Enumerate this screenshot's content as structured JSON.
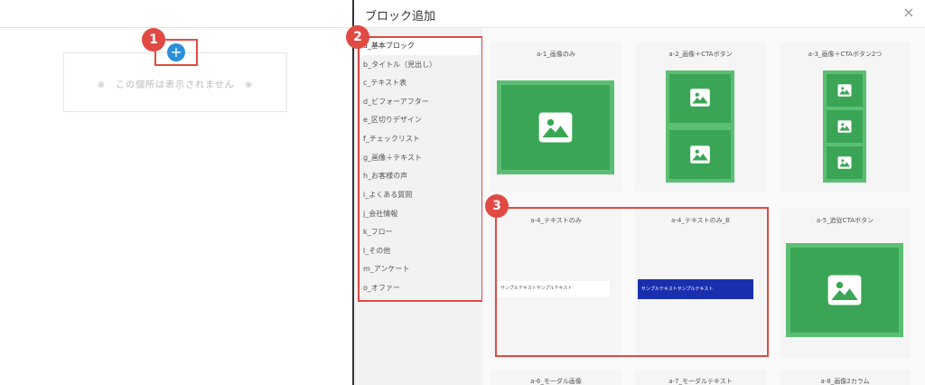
{
  "editor": {
    "placeholder": "※　この個所は表示されません　※",
    "add_button": "+"
  },
  "badges": [
    "1",
    "2",
    "3"
  ],
  "modal": {
    "title": "ブロック追加",
    "close": "×"
  },
  "categories": [
    "a_基本ブロック",
    "b_タイトル（見出し）",
    "c_テキスト表",
    "d_ビフォーアフター",
    "e_区切りデザイン",
    "f_チェックリスト",
    "g_画像＋テキスト",
    "h_お客様の声",
    "i_よくある質問",
    "j_会社情報",
    "k_フロー",
    "l_その他",
    "m_アンケート",
    "o_オファー"
  ],
  "blocks": [
    {
      "title": "a-1_画像のみ",
      "type": "image-1"
    },
    {
      "title": "a-2_画像＋CTAボタン",
      "type": "image-2"
    },
    {
      "title": "a-3_画像＋CTAボタン2つ",
      "type": "image-3"
    },
    {
      "title": "a-4_テキストのみ",
      "type": "text",
      "sample": "サンプルテキストサンプルテキスト"
    },
    {
      "title": "a-4_テキストのみ_B",
      "type": "text-b",
      "sample": "サンプルテキストサンプルテキスト"
    },
    {
      "title": "a-5_追従CTAボタン",
      "type": "image-1"
    },
    {
      "title": "a-6_モーダル画像",
      "type": "partial"
    },
    {
      "title": "a-7_モーダルテキスト",
      "type": "partial"
    },
    {
      "title": "a-8_画像2カラム",
      "type": "partial"
    }
  ],
  "colors": {
    "accent_red": "#e04a43",
    "add_blue": "#2b8fdc",
    "thumb_green": "#5bbf73",
    "thumb_green_dark": "#3aa655",
    "text_b_bg": "#1a2fb0"
  }
}
